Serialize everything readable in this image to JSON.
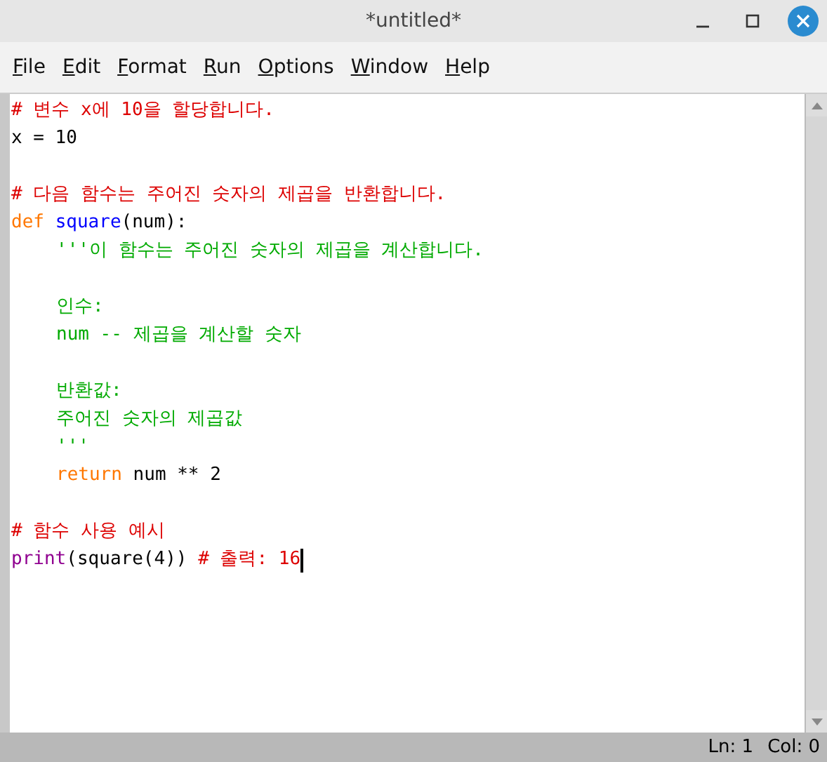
{
  "window": {
    "title": "*untitled*"
  },
  "menu": [
    "File",
    "Edit",
    "Format",
    "Run",
    "Options",
    "Window",
    "Help"
  ],
  "editor": {
    "lines": [
      {
        "kind": "code",
        "indent": false,
        "tokens": [
          {
            "kind": "comment",
            "text": "# 변수 x에 10을 할당합니다."
          }
        ]
      },
      {
        "kind": "code",
        "indent": false,
        "tokens": [
          {
            "kind": "plain",
            "text": "x = 10"
          }
        ]
      },
      {
        "kind": "blank"
      },
      {
        "kind": "code",
        "indent": false,
        "tokens": [
          {
            "kind": "comment",
            "text": "# 다음 함수는 주어진 숫자의 제곱을 반환합니다."
          }
        ]
      },
      {
        "kind": "code",
        "indent": false,
        "tokens": [
          {
            "kind": "keyword",
            "text": "def "
          },
          {
            "kind": "definition",
            "text": "square"
          },
          {
            "kind": "plain",
            "text": "(num):"
          }
        ]
      },
      {
        "kind": "code",
        "indent": true,
        "tokens": [
          {
            "kind": "string",
            "text": "'''이 함수는 주어진 숫자의 제곱을 계산합니다."
          }
        ]
      },
      {
        "kind": "blank"
      },
      {
        "kind": "code",
        "indent": true,
        "tokens": [
          {
            "kind": "string",
            "text": "인수:"
          }
        ]
      },
      {
        "kind": "code",
        "indent": true,
        "tokens": [
          {
            "kind": "string",
            "text": "num -- 제곱을 계산할 숫자"
          }
        ]
      },
      {
        "kind": "blank"
      },
      {
        "kind": "code",
        "indent": true,
        "tokens": [
          {
            "kind": "string",
            "text": "반환값:"
          }
        ]
      },
      {
        "kind": "code",
        "indent": true,
        "tokens": [
          {
            "kind": "string",
            "text": "주어진 숫자의 제곱값"
          }
        ]
      },
      {
        "kind": "code",
        "indent": true,
        "tokens": [
          {
            "kind": "string",
            "text": "'''"
          }
        ]
      },
      {
        "kind": "code",
        "indent": true,
        "tokens": [
          {
            "kind": "keyword",
            "text": "return"
          },
          {
            "kind": "plain",
            "text": " num ** 2"
          }
        ]
      },
      {
        "kind": "blank"
      },
      {
        "kind": "code",
        "indent": false,
        "tokens": [
          {
            "kind": "comment",
            "text": "# 함수 사용 예시"
          }
        ]
      },
      {
        "kind": "code",
        "indent": false,
        "tokens": [
          {
            "kind": "builtin",
            "text": "print"
          },
          {
            "kind": "plain",
            "text": "(square(4)) "
          },
          {
            "kind": "comment",
            "text": "# 출력: 16"
          }
        ]
      }
    ]
  },
  "status_bar": {
    "line": "Ln: 1",
    "column": "Col: 0"
  }
}
